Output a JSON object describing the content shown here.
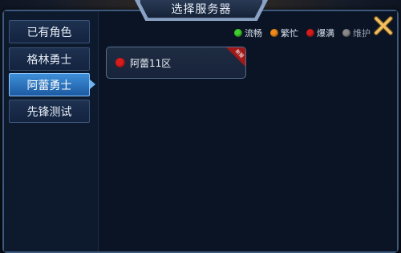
{
  "dialog": {
    "title": "选择服务器"
  },
  "sidebar": {
    "items": [
      {
        "label": "已有角色",
        "active": false
      },
      {
        "label": "格林勇士",
        "active": false
      },
      {
        "label": "阿蕾勇士",
        "active": true
      },
      {
        "label": "先锋测试",
        "active": false
      }
    ]
  },
  "legend": [
    {
      "label": "流畅",
      "color": "#3fcf2f"
    },
    {
      "label": "繁忙",
      "color": "#f08a1c"
    },
    {
      "label": "爆满",
      "color": "#d81c1c"
    },
    {
      "label": "维护",
      "color": "#8a8a8a"
    }
  ],
  "servers": [
    {
      "name": "阿蕾11区",
      "status_color": "#d81c1c",
      "badge": "新服"
    }
  ],
  "colors": {
    "accent": "#3e8fd8",
    "panel": "#0c1626"
  },
  "icons": {
    "close": "close-icon"
  }
}
